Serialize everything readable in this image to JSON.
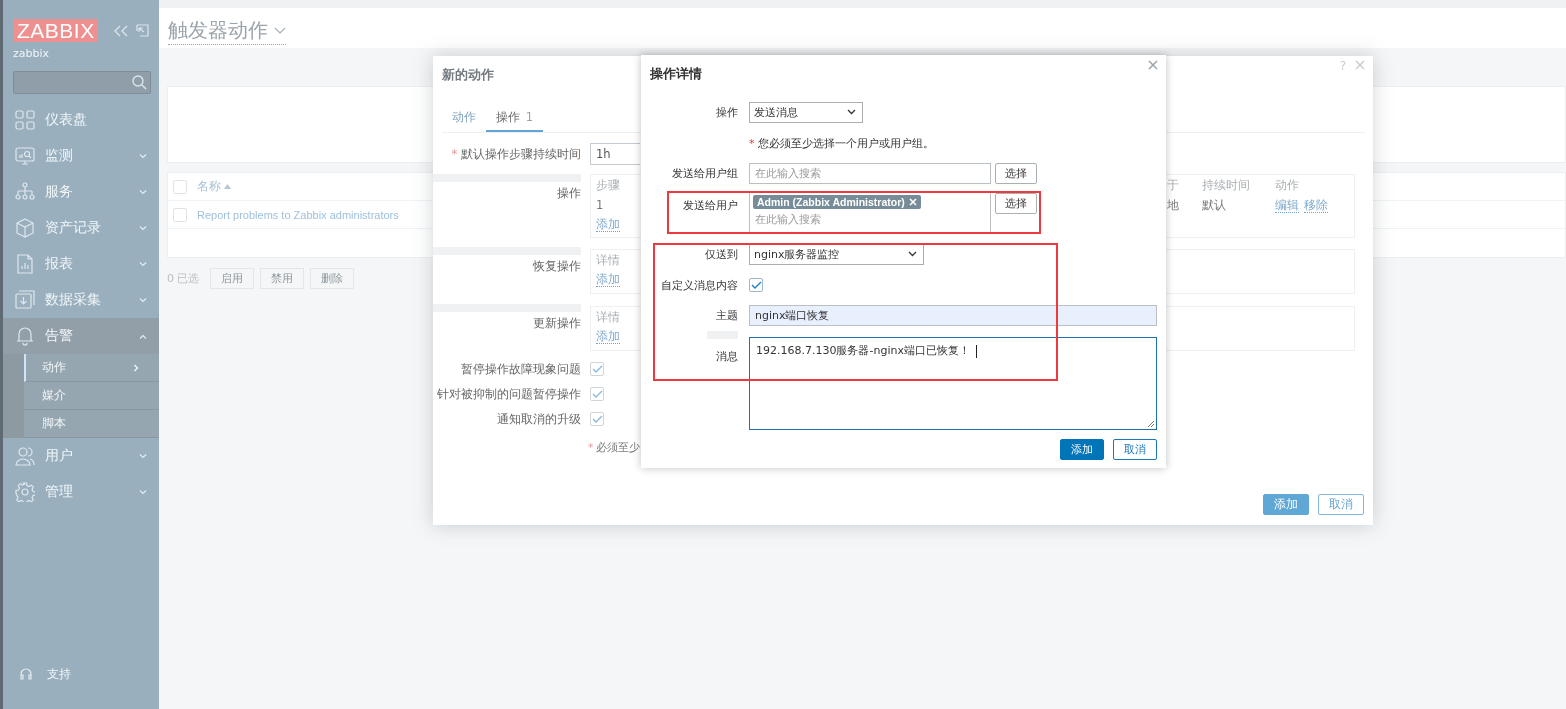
{
  "sidebar": {
    "logo": "ZABBIX",
    "server_name": "zabbix",
    "menu": [
      {
        "label": "仪表盘",
        "kind": "dashboard",
        "expandable": false,
        "expanded": false
      },
      {
        "label": "监测",
        "kind": "monitor",
        "expandable": true,
        "expanded": false
      },
      {
        "label": "服务",
        "kind": "services",
        "expandable": true,
        "expanded": false
      },
      {
        "label": "资产记录",
        "kind": "inventory",
        "expandable": true,
        "expanded": false
      },
      {
        "label": "报表",
        "kind": "reports",
        "expandable": true,
        "expanded": false
      },
      {
        "label": "数据采集",
        "kind": "collect",
        "expandable": true,
        "expanded": false
      },
      {
        "label": "告警",
        "kind": "alerts",
        "expandable": true,
        "expanded": true,
        "children": [
          {
            "label": "动作",
            "selected": true
          },
          {
            "label": "媒介",
            "selected": false
          },
          {
            "label": "脚本",
            "selected": false
          }
        ]
      },
      {
        "label": "用户",
        "kind": "users",
        "expandable": true,
        "expanded": false
      },
      {
        "label": "管理",
        "kind": "admin",
        "expandable": true,
        "expanded": false
      }
    ],
    "footer": [
      {
        "label": "支持",
        "kind": "support"
      }
    ]
  },
  "page": {
    "title": "触发器动作"
  },
  "actions_table": {
    "header_checked": false,
    "columns": [
      {
        "label": "名称",
        "sorted": true
      }
    ],
    "rows": [
      {
        "name": "Report problems to Zabbix administrators",
        "checked": false
      }
    ]
  },
  "selection": {
    "count": "0 已选",
    "buttons": [
      "启用",
      "禁用",
      "删除"
    ]
  },
  "action_dialog": {
    "title": "新的动作",
    "help": "?",
    "tabs": [
      {
        "label": "动作",
        "selected": false
      },
      {
        "label": "操作",
        "count": "1",
        "selected": true
      }
    ],
    "duration": {
      "required_mark": "*",
      "label": "默认操作步骤持续时间",
      "value": "1h"
    },
    "operations": {
      "label": "操作",
      "columns": [
        "步骤",
        "于",
        "持续时间",
        "动作"
      ],
      "rows": [
        {
          "step": "1",
          "column_3": "地",
          "duration": "默认",
          "actions": [
            "编辑",
            "移除"
          ]
        }
      ],
      "add_link": "添加"
    },
    "recovery": {
      "label": "恢复操作",
      "header": "详情",
      "add_link": "添加"
    },
    "update": {
      "label": "更新操作",
      "header": "详情",
      "add_link": "添加"
    },
    "checks": [
      {
        "label": "暂停操作故障现象问题",
        "checked": true
      },
      {
        "label": "针对被抑制的问题暂停操作",
        "checked": true
      },
      {
        "label": "通知取消的升级",
        "checked": true
      }
    ],
    "note": {
      "required_mark": "*",
      "text": "必须至少"
    },
    "buttons": [
      {
        "label": "添加",
        "primary": true
      },
      {
        "label": "取消",
        "primary": false
      }
    ]
  },
  "details_dialog": {
    "title": "操作详情",
    "operation": {
      "label": "操作",
      "value": "发送消息"
    },
    "note": {
      "required_mark": "*",
      "text": "您必须至少选择一个用户或用户组。"
    },
    "user_groups": {
      "label": "发送给用户组",
      "placeholder": "在此输入搜索",
      "button": "选择"
    },
    "users": {
      "label": "发送给用户",
      "tags": [
        "Admin (Zabbix Administrator)"
      ],
      "placeholder": "在此输入搜索",
      "button": "选择"
    },
    "send_only_to": {
      "label": "仅送到",
      "value": "nginx服务器监控"
    },
    "custom_message": {
      "label": "自定义消息内容",
      "checked": true
    },
    "subject": {
      "label": "主题",
      "value": "nginx端口恢复"
    },
    "message": {
      "label": "消息",
      "value": "192.168.7.130服务器-nginx端口已恢复！",
      "focused": true
    },
    "buttons": [
      {
        "label": "添加",
        "primary": true
      },
      {
        "label": "取消",
        "primary": false
      }
    ]
  },
  "highlight_boxes": [
    {
      "kind": "rect"
    },
    {
      "kind": "rect"
    }
  ]
}
